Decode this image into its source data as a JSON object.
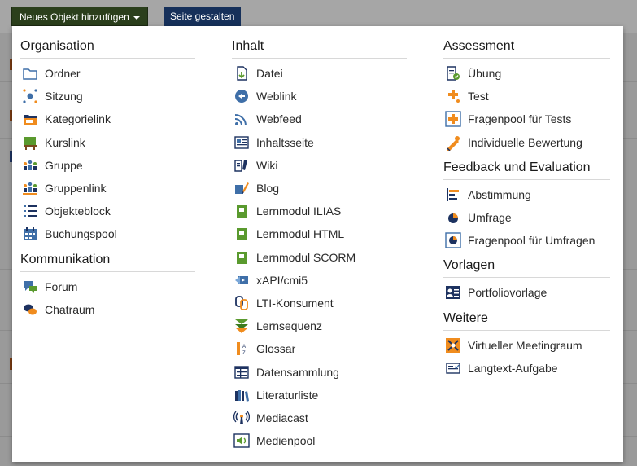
{
  "toolbar": {
    "add_label": "Neues Objekt hinzufügen",
    "page_label": "Seite gestalten"
  },
  "colors": {
    "add_button": "#2b3f1c",
    "page_button": "#16305a",
    "icon_green": "#5a9a2e",
    "icon_blue": "#3f6fa8",
    "icon_orange": "#f08c1e"
  },
  "columns": [
    {
      "groups": [
        {
          "title": "Organisation",
          "items": [
            {
              "label": "Ordner",
              "icon": "folder-icon"
            },
            {
              "label": "Sitzung",
              "icon": "session-icon"
            },
            {
              "label": "Kategorielink",
              "icon": "category-link-icon"
            },
            {
              "label": "Kurslink",
              "icon": "course-link-icon"
            },
            {
              "label": "Gruppe",
              "icon": "group-icon"
            },
            {
              "label": "Gruppenlink",
              "icon": "group-link-icon"
            },
            {
              "label": "Objekteblock",
              "icon": "item-block-icon"
            },
            {
              "label": "Buchungspool",
              "icon": "booking-pool-icon"
            }
          ]
        },
        {
          "title": "Kommunikation",
          "items": [
            {
              "label": "Forum",
              "icon": "forum-icon"
            },
            {
              "label": "Chatraum",
              "icon": "chatroom-icon"
            }
          ]
        }
      ]
    },
    {
      "groups": [
        {
          "title": "Inhalt",
          "items": [
            {
              "label": "Datei",
              "icon": "file-icon"
            },
            {
              "label": "Weblink",
              "icon": "weblink-icon"
            },
            {
              "label": "Webfeed",
              "icon": "webfeed-icon"
            },
            {
              "label": "Inhaltsseite",
              "icon": "content-page-icon"
            },
            {
              "label": "Wiki",
              "icon": "wiki-icon"
            },
            {
              "label": "Blog",
              "icon": "blog-icon"
            },
            {
              "label": "Lernmodul ILIAS",
              "icon": "learning-module-icon"
            },
            {
              "label": "Lernmodul HTML",
              "icon": "learning-module-icon"
            },
            {
              "label": "Lernmodul SCORM",
              "icon": "learning-module-icon"
            },
            {
              "label": "xAPI/cmi5",
              "icon": "xapi-icon"
            },
            {
              "label": "LTI-Konsument",
              "icon": "lti-icon"
            },
            {
              "label": "Lernsequenz",
              "icon": "learning-sequence-icon"
            },
            {
              "label": "Glossar",
              "icon": "glossary-icon"
            },
            {
              "label": "Datensammlung",
              "icon": "data-collection-icon"
            },
            {
              "label": "Literaturliste",
              "icon": "bibliography-icon"
            },
            {
              "label": "Mediacast",
              "icon": "mediacast-icon"
            },
            {
              "label": "Medienpool",
              "icon": "media-pool-icon"
            }
          ]
        }
      ]
    },
    {
      "groups": [
        {
          "title": "Assessment",
          "items": [
            {
              "label": "Übung",
              "icon": "exercise-icon"
            },
            {
              "label": "Test",
              "icon": "test-icon"
            },
            {
              "label": "Fragenpool für Tests",
              "icon": "question-pool-icon"
            },
            {
              "label": "Individuelle Bewertung",
              "icon": "individual-assessment-icon"
            }
          ]
        },
        {
          "title": "Feedback und Evaluation",
          "items": [
            {
              "label": "Abstimmung",
              "icon": "poll-icon"
            },
            {
              "label": "Umfrage",
              "icon": "survey-icon"
            },
            {
              "label": "Fragenpool für Umfragen",
              "icon": "survey-pool-icon"
            }
          ]
        },
        {
          "title": "Vorlagen",
          "items": [
            {
              "label": "Portfoliovorlage",
              "icon": "portfolio-template-icon"
            }
          ]
        },
        {
          "title": "Weitere",
          "items": [
            {
              "label": "Virtueller Meetingraum",
              "icon": "virtual-meeting-icon"
            },
            {
              "label": "Langtext-Aufgabe",
              "icon": "long-text-task-icon"
            }
          ]
        }
      ]
    }
  ]
}
